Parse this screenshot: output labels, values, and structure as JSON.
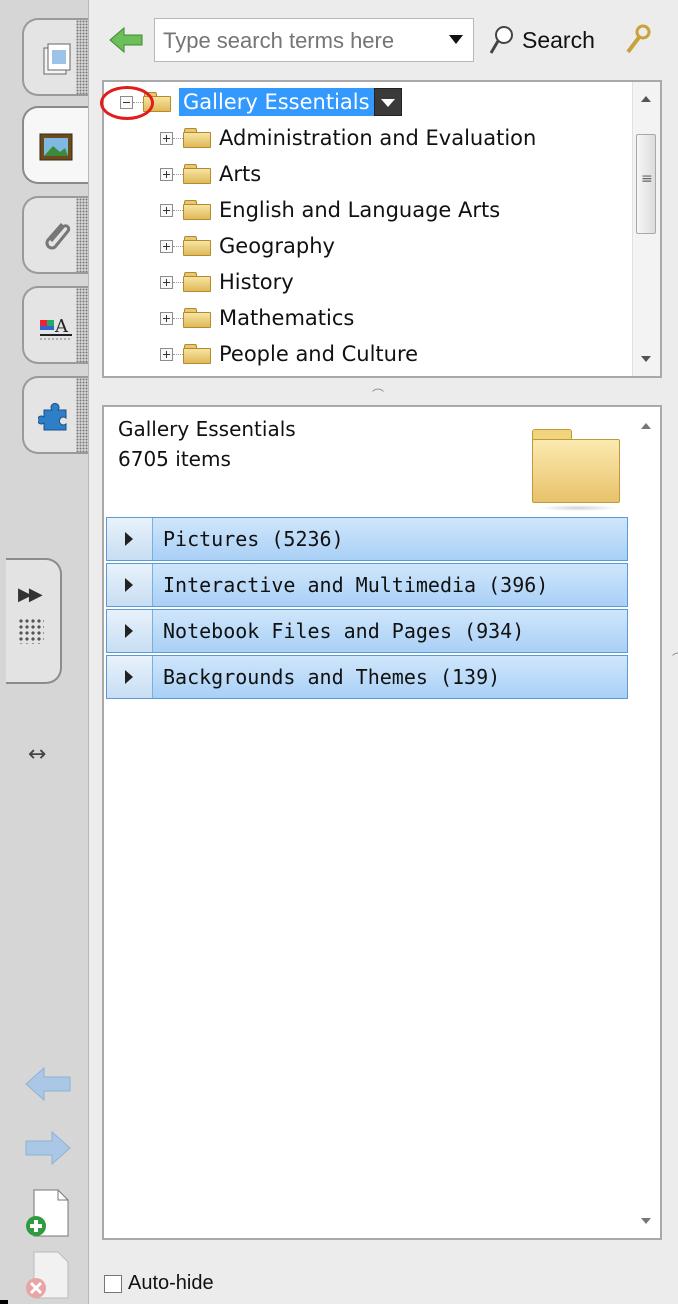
{
  "search": {
    "placeholder": "Type search terms here",
    "button_label": "Search"
  },
  "tree": {
    "root": "Gallery Essentials",
    "children": [
      "Administration and Evaluation",
      "Arts",
      "English and Language Arts",
      "Geography",
      "History",
      "Mathematics",
      "People and Culture"
    ]
  },
  "content": {
    "title": "Gallery Essentials",
    "count": "6705 items",
    "categories": [
      "Pictures (5236)",
      "Interactive and Multimedia (396)",
      "Notebook Files and Pages (934)",
      "Backgrounds and Themes (139)"
    ]
  },
  "footer": {
    "autohide_label": "Auto-hide"
  },
  "colors": {
    "selection": "#3399ff",
    "highlight_circle": "#e21b1b",
    "category_bar": "#a9d0f6"
  }
}
